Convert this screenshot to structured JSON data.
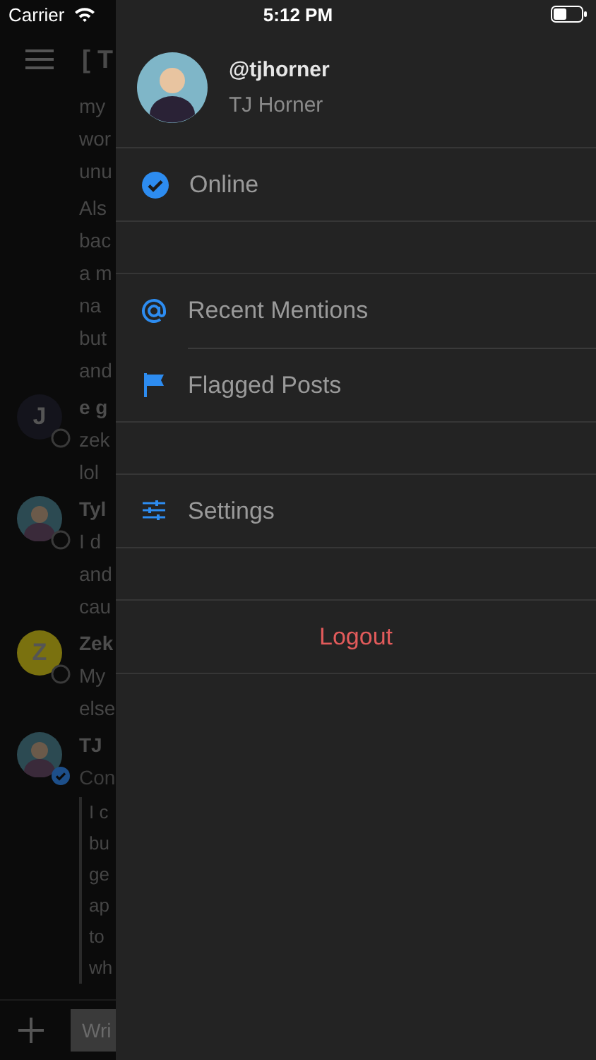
{
  "status_bar": {
    "carrier": "Carrier",
    "time": "5:12 PM"
  },
  "channel": {
    "title": "[ T",
    "posts": [
      {
        "kind": "continuation",
        "lines": [
          "my",
          "wor",
          "unu"
        ]
      },
      {
        "kind": "continuation",
        "lines": [
          "Als",
          "bac",
          "a m",
          "na",
          "but",
          "and"
        ]
      },
      {
        "kind": "post",
        "author": "e g",
        "avatar": {
          "kind": "letter",
          "letter": "J",
          "color": "#14141c"
        },
        "online": false,
        "lines": [
          "zek",
          "lol"
        ]
      },
      {
        "kind": "post",
        "author": "Tyl",
        "online": false,
        "lines": [
          "I d",
          "and",
          "cau"
        ]
      },
      {
        "kind": "post",
        "author": "Zek",
        "avatar": {
          "kind": "letter",
          "letter": "Z",
          "color": "#7a710f"
        },
        "online": false,
        "lines": [
          "My",
          "else"
        ]
      },
      {
        "kind": "post",
        "author": "TJ",
        "online": true,
        "subtitle": "Con",
        "quote": [
          "I c",
          "bu",
          "ge",
          "ap",
          "to",
          "wh"
        ]
      }
    ],
    "composer": {
      "placeholder": "Wri"
    }
  },
  "drawer": {
    "username": "@tjhorner",
    "display_name": "TJ Horner",
    "menu": [
      {
        "kind": "status",
        "label": "Online",
        "checked": true
      },
      {
        "kind": "spacer"
      },
      {
        "kind": "mentions",
        "label": "Recent Mentions"
      },
      {
        "kind": "flags",
        "label": "Flagged Posts"
      },
      {
        "kind": "spacer"
      },
      {
        "kind": "settings",
        "label": "Settings"
      },
      {
        "kind": "spacer"
      },
      {
        "kind": "logout",
        "label": "Logout"
      }
    ]
  }
}
